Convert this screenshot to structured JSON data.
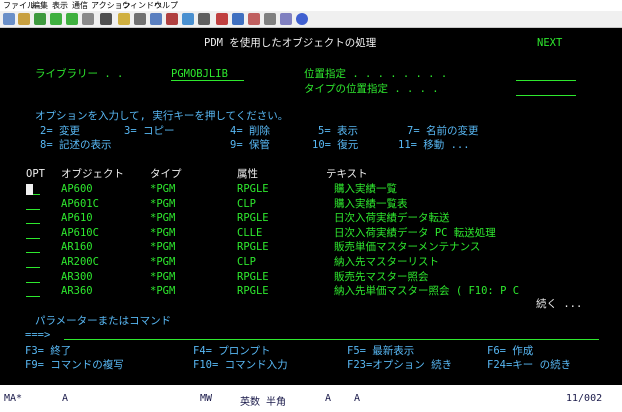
{
  "menu": [
    "ファイル",
    "編集",
    "表示",
    "通信",
    "アクション",
    "ウィンドウ",
    "ヘルプ"
  ],
  "screen": {
    "title": "PDM を使用したオブジェクトの処理",
    "next": "NEXT",
    "library_label": "ライブラリー . .",
    "library_value": "PGMOBJLIB",
    "position_label": "位置指定 . . . . . . . .",
    "type_position_label": "タイプの位置指定 . . . .",
    "option_prompt": "オプションを入力して, 実行キーを押してください。",
    "options_row1": [
      "2= 変更",
      "3= コピー",
      "4= 削除",
      "5= 表示",
      "7= 名前の変更"
    ],
    "options_row2": [
      "8= 記述の表示",
      "9= 保管",
      "10= 復元",
      "11= 移動 ..."
    ],
    "headers": {
      "opt": "OPT",
      "object": "オブジェクト",
      "type": "タイプ",
      "attr": "属性",
      "text": "テキスト"
    },
    "rows": [
      {
        "object": "AP600",
        "type": "*PGM",
        "attr": "RPGLE",
        "text": "購入実績一覧"
      },
      {
        "object": "AP601C",
        "type": "*PGM",
        "attr": "CLP",
        "text": "購入実績一覧表"
      },
      {
        "object": "AP610",
        "type": "*PGM",
        "attr": "RPGLE",
        "text": "日次入荷実績データ転送"
      },
      {
        "object": "AP610C",
        "type": "*PGM",
        "attr": "CLLE",
        "text": "日次入荷実績データ PC 転送処理"
      },
      {
        "object": "AR160",
        "type": "*PGM",
        "attr": "RPGLE",
        "text": "販売単価マスターメンテナンス"
      },
      {
        "object": "AR200C",
        "type": "*PGM",
        "attr": "CLP",
        "text": "納入先マスターリスト"
      },
      {
        "object": "AR300",
        "type": "*PGM",
        "attr": "RPGLE",
        "text": "販売先マスター照会"
      },
      {
        "object": "AR360",
        "type": "*PGM",
        "attr": "RPGLE",
        "text": "納入先単価マスター照会 ( F10: P C"
      }
    ],
    "more": "続く ...",
    "param_label": "パラメーターまたはコマンド",
    "command_prompt": "===>",
    "fkeys_row1": [
      "F3= 終了",
      "F4= プロンプト",
      "F5= 最新表示",
      "F6= 作成"
    ],
    "fkeys_row2": [
      "F9= コマンドの複写",
      "F10= コマンド入力",
      "F23=オプション 続き",
      "F24=キー の続き"
    ]
  },
  "status": {
    "session": "MA*",
    "a1": "A",
    "mw": "MW",
    "mode": "英数 半角",
    "a2": "A",
    "a3": "A",
    "position": "11/002"
  },
  "colors": {
    "terminal_bg": "#000000",
    "green": "#2ee82e",
    "white": "#f0f0f0",
    "blue": "#58b8f4"
  },
  "toolbar_icons": [
    "copy-icon",
    "paste-icon",
    "transfer-icon",
    "upload-icon",
    "download-icon",
    "file-icon",
    "macro-icon",
    "record-icon",
    "stop-icon",
    "play-icon",
    "settings-icon",
    "keyboard-icon",
    "display-icon",
    "edit-icon",
    "connect-icon",
    "disconnect-icon",
    "print-icon",
    "image-icon",
    "help-icon"
  ]
}
